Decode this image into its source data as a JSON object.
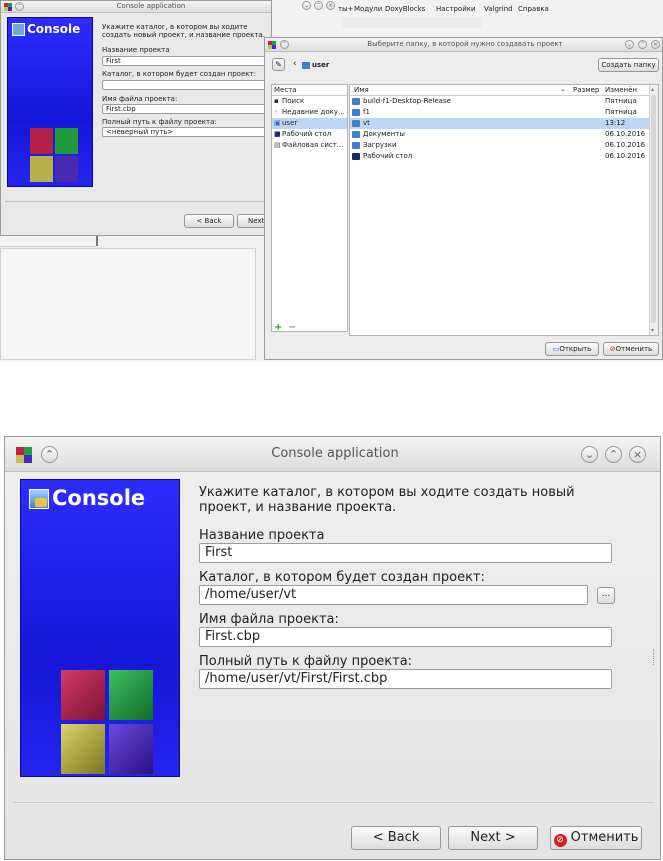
{
  "top": {
    "bg_window": {
      "title": "Console application",
      "banner_text": "Console",
      "heading": "Укажите каталог, в котором вы ходите создать новый проект, и название проекта.",
      "name_label": "Название проекта",
      "name_value": "First",
      "dir_label": "Каталог, в котором будет создан проект:",
      "dir_value": "",
      "file_label": "Имя файла проекта:",
      "file_value": "First.cbp",
      "path_label": "Полный путь к файлу проекта:",
      "path_value": "<неверный путь>",
      "back_label": "< Back",
      "next_label": "Next"
    },
    "ide_menu": [
      "ты+",
      "Модули",
      "DoxyBlocks",
      "Настройки",
      "Valgrind",
      "Справка"
    ],
    "dialog": {
      "title": "Выберите папку, в которой нужно создавать проект",
      "location": "user",
      "create_folder_label": "Создать папку",
      "places_header": "Места",
      "places": [
        "Поиск",
        "Недавние доку...",
        "user",
        "Рабочий стол",
        "Файловая сист..."
      ],
      "columns": {
        "name": "Имя",
        "size": "Размер",
        "modified": "Изменён"
      },
      "files": [
        {
          "name": "build-f1-Desktop-Release",
          "modified": "Пятница"
        },
        {
          "name": "f1",
          "modified": "Пятница"
        },
        {
          "name": "vt",
          "modified": "13:12"
        },
        {
          "name": "Документы",
          "modified": "06.10.2016"
        },
        {
          "name": "Загрузки",
          "modified": "06.10.2016"
        },
        {
          "name": "Рабочий стол",
          "modified": "06.10.2016"
        }
      ],
      "open_label": "Открыть",
      "cancel_label": "Отменить"
    }
  },
  "bottom": {
    "title": "Console application",
    "banner_text": "Console",
    "heading": "Укажите каталог, в котором вы ходите создать новый проект, и название проекта.",
    "name_label": "Название проекта",
    "name_value": "First",
    "dir_label": "Каталог, в котором будет создан проект:",
    "dir_value": "/home/user/vt",
    "browse_label": "...",
    "file_label": "Имя файла проекта:",
    "file_value": "First.cbp",
    "path_label": "Полный путь к файлу проекта:",
    "path_value": "/home/user/vt/First/First.cbp",
    "back_label": "< Back",
    "next_label": "Next >",
    "cancel_label": "Отменить"
  },
  "colors": {
    "banner_blue": "#1c1cf0",
    "selection": "#bcd7f3",
    "cube_red": "#b3204a",
    "cube_green": "#1f9a3a",
    "cube_yellow": "#b8b14a",
    "cube_purple": "#4a2ab0"
  }
}
